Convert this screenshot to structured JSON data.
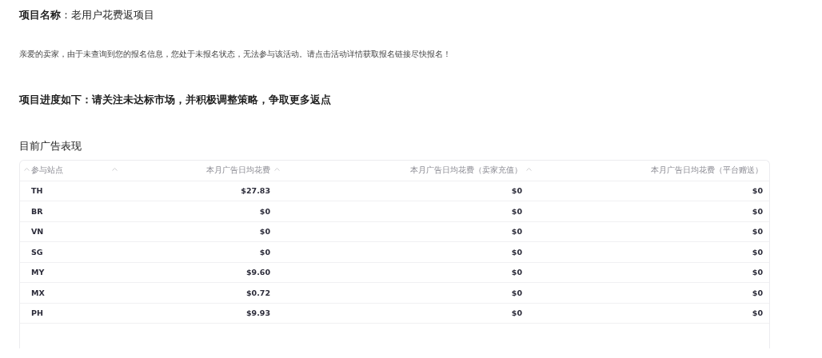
{
  "project": {
    "label": "项目名称",
    "separator": "：",
    "name": "老用户花费返项目"
  },
  "notice": "亲爱的卖家，由于未查询到您的报名信息，您处于未报名状态，无法参与该活动。请点击活动详情获取报名链接尽快报名！",
  "progress_heading": "项目进度如下：请关注未达标市场，并积极调整策略，争取更多返点",
  "section_title": "目前广告表现",
  "table": {
    "columns": [
      {
        "label": "参与站点",
        "kind": "text",
        "sortable": true
      },
      {
        "label": "本月广告日均花费",
        "kind": "number",
        "sortable": true
      },
      {
        "label": "本月广告日均花费（卖家充值）",
        "kind": "number",
        "sortable": true
      },
      {
        "label": "本月广告日均花费（平台赠送）",
        "kind": "number",
        "sortable": false
      }
    ],
    "rows": [
      [
        "TH",
        "$27.83",
        "$0",
        "$0"
      ],
      [
        "BR",
        "$0",
        "$0",
        "$0"
      ],
      [
        "VN",
        "$0",
        "$0",
        "$0"
      ],
      [
        "SG",
        "$0",
        "$0",
        "$0"
      ],
      [
        "MY",
        "$9.60",
        "$0",
        "$0"
      ],
      [
        "MX",
        "$0.72",
        "$0",
        "$0"
      ],
      [
        "PH",
        "$9.93",
        "$0",
        "$0"
      ]
    ]
  }
}
